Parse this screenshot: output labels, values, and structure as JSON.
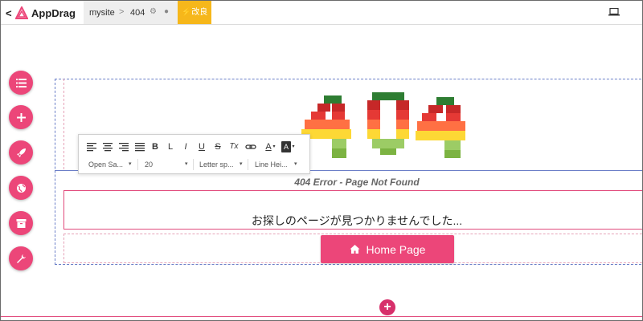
{
  "topbar": {
    "back_glyph": "<",
    "app_name": "AppDrag",
    "site_name": "mysite",
    "separator": ">",
    "page_name": "404",
    "improve_label": "⚡改良",
    "icons": [
      "appdrag-logo-icon",
      "gear-icon",
      "globe-icon",
      "laptop-icon"
    ]
  },
  "tools": [
    {
      "name": "list-icon"
    },
    {
      "name": "plus-icon"
    },
    {
      "name": "rocket-icon"
    },
    {
      "name": "globe-icon"
    },
    {
      "name": "archive-icon"
    },
    {
      "name": "wrench-icon"
    }
  ],
  "toolbar": {
    "bold": "B",
    "italic": "I",
    "underline": "U",
    "strike": "S",
    "clear": "Tx",
    "font_color": "A",
    "font_family": "Open Sa...",
    "font_size": "20",
    "letter_spacing": "Letter sp...",
    "line_height": "Line Hei..."
  },
  "content": {
    "caption": "404 Error - Page Not Found",
    "message": "お探しのページが見つかりませんでした...",
    "home_button": "Home Page"
  },
  "colors": {
    "accent": "#ec4679",
    "improve": "#f6b71b",
    "guide_blue": "#6b7fc8",
    "guide_pink": "#e14a7c"
  }
}
